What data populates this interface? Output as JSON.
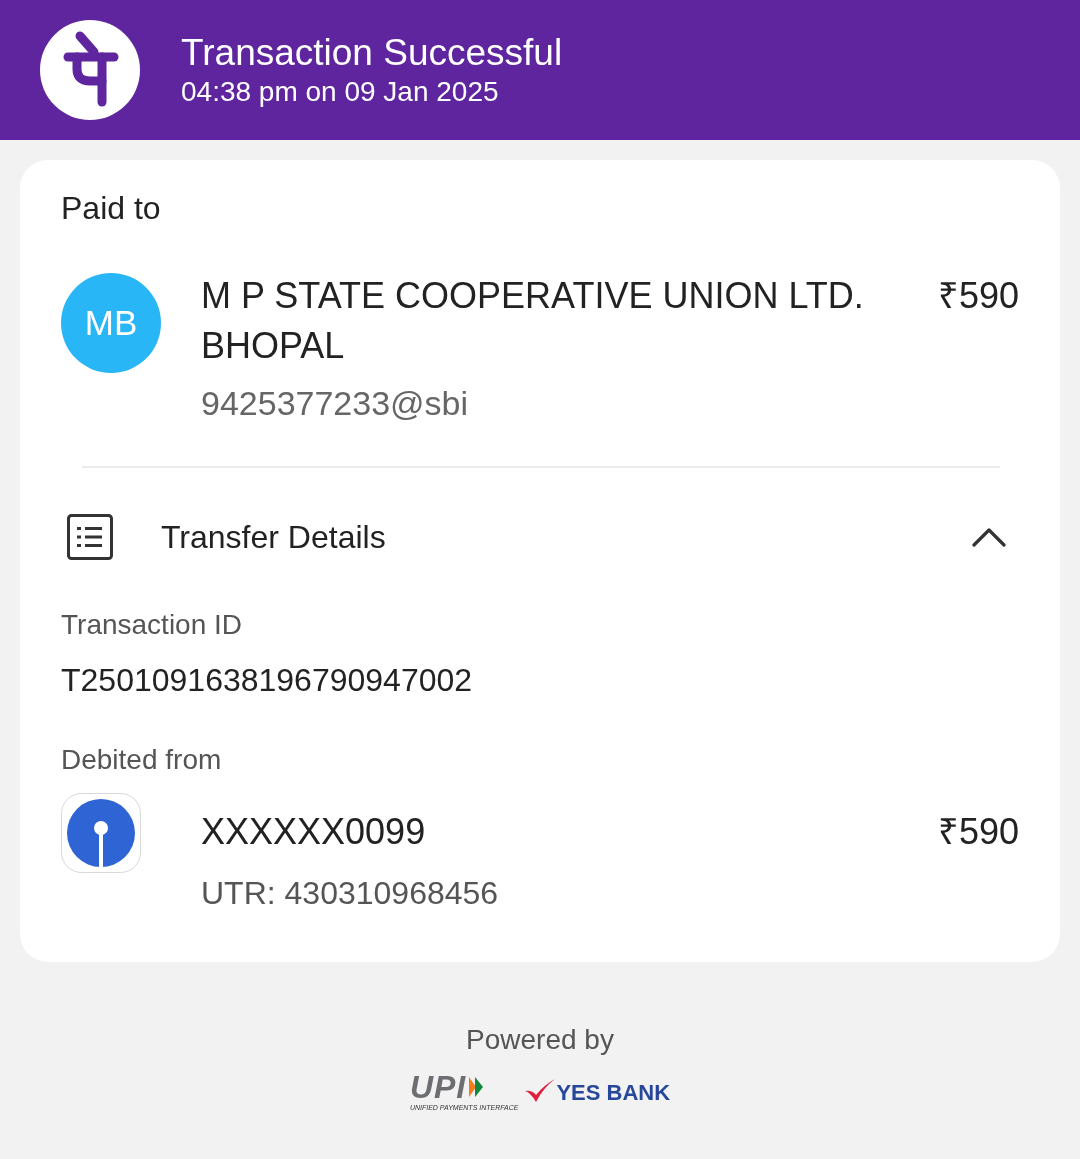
{
  "header": {
    "title": "Transaction Successful",
    "subtitle": "04:38 pm on 09 Jan 2025"
  },
  "paid_to": {
    "label": "Paid to",
    "avatar_initials": "MB",
    "payee_name": "M P STATE COOPERATIVE UNION LTD. BHOPAL",
    "amount": "₹590",
    "upi_id": "9425377233@sbi"
  },
  "transfer_details": {
    "title": "Transfer Details",
    "expanded": true,
    "fields": [
      {
        "label": "Transaction ID",
        "value": "T2501091638196790947002"
      }
    ],
    "debited_from": {
      "label": "Debited from",
      "account": "XXXXXX0099",
      "amount": "₹590",
      "utr": "UTR: 430310968456"
    }
  },
  "footer": {
    "powered_by": "Powered by",
    "upi_wordmark": "UPI",
    "upi_tagline": "UNIFIED PAYMENTS INTERFACE",
    "bank_name": "YES BANK"
  }
}
